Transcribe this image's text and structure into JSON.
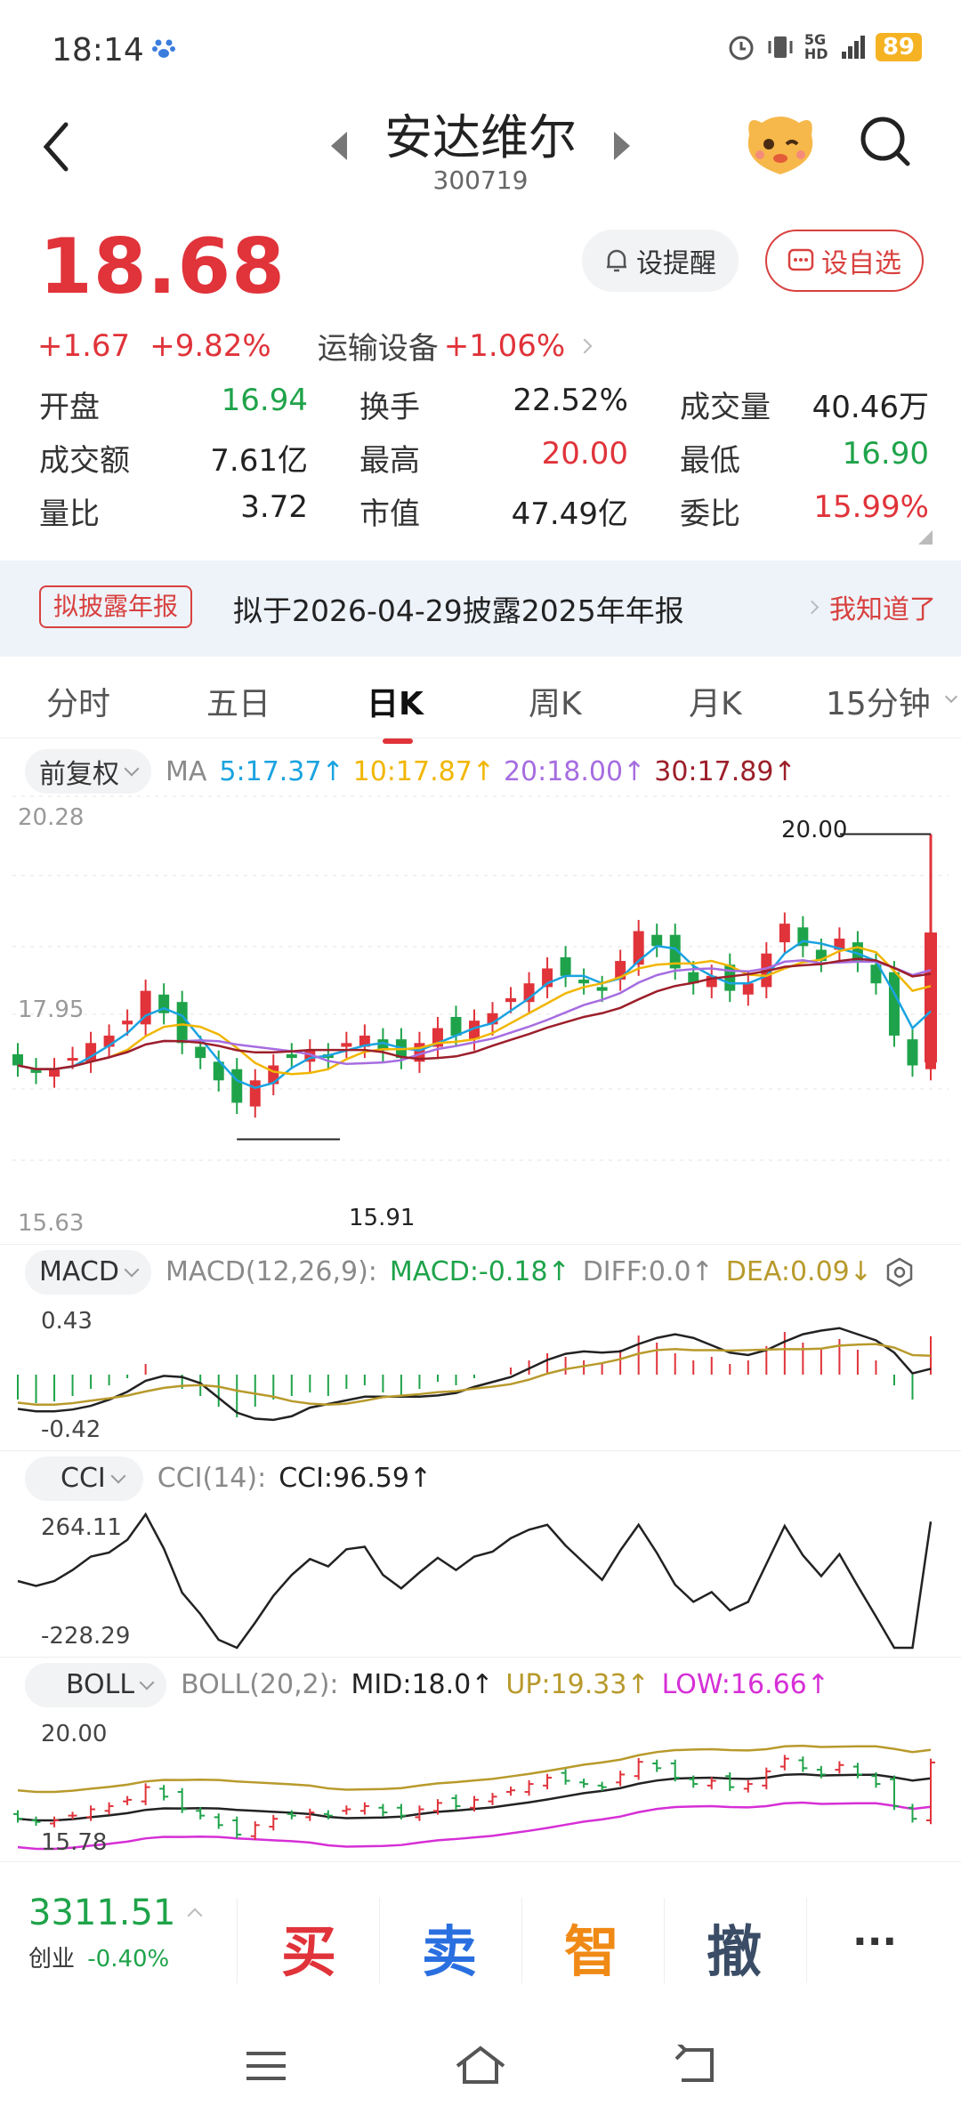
{
  "status_bar": {
    "time": "18:14",
    "network": "5G HD",
    "battery": "89"
  },
  "header": {
    "title": "安达维尔",
    "code": "300719"
  },
  "quote": {
    "price": "18.68",
    "change": "+1.67",
    "change_pct": "+9.82%",
    "sector": "运输设备",
    "sector_change": "+1.06%",
    "remind_label": "设提醒",
    "watch_label": "设自选",
    "stats": [
      [
        {
          "label": "开盘",
          "value": "16.94",
          "color": "green"
        },
        {
          "label": "换手",
          "value": "22.52%",
          "color": "dark"
        },
        {
          "label": "成交量",
          "value": "40.46万",
          "color": "dark"
        }
      ],
      [
        {
          "label": "成交额",
          "value": "7.61亿",
          "color": "dark"
        },
        {
          "label": "最高",
          "value": "20.00",
          "color": "red"
        },
        {
          "label": "最低",
          "value": "16.90",
          "color": "green"
        }
      ],
      [
        {
          "label": "量比",
          "value": "3.72",
          "color": "dark"
        },
        {
          "label": "市值",
          "value": "47.49亿",
          "color": "dark"
        },
        {
          "label": "委比",
          "value": "15.99%",
          "color": "red"
        }
      ]
    ]
  },
  "notice": {
    "badge": "拟披露年报",
    "text": "拟于2026-04-29披露2025年年报",
    "action": "我知道了"
  },
  "tabs": [
    "分时",
    "五日",
    "日K",
    "周K",
    "月K",
    "15分钟"
  ],
  "active_tab": "日K",
  "kline": {
    "adjust": "前复权",
    "ma_label": "MA",
    "ma": [
      {
        "text": "5:17.37↑",
        "color": "#1aa3e0"
      },
      {
        "text": "10:17.87↑",
        "color": "#f1b600"
      },
      {
        "text": "20:18.00↑",
        "color": "#a66de0"
      },
      {
        "text": "30:17.89↑",
        "color": "#9c1f2a"
      }
    ],
    "ymax": "20.28",
    "ymid": "17.95",
    "ymin": "15.63",
    "high_mark": "20.00",
    "low_mark": "15.91"
  },
  "macd": {
    "name": "MACD",
    "params": "MACD(12,26,9):",
    "macd": "MACD:-0.18↑",
    "diff": "DIFF:0.0↑",
    "dea": "DEA:0.09↓",
    "ymax": "0.43",
    "ymin": "-0.42"
  },
  "cci": {
    "name": "CCI",
    "params": "CCI(14):",
    "value": "CCI:96.59↑",
    "ymax": "264.11",
    "ymin": "-228.29"
  },
  "boll": {
    "name": "BOLL",
    "params": "BOLL(20,2):",
    "mid": "MID:18.0↑",
    "up": "UP:19.33↑",
    "low": "LOW:16.66↑",
    "ymax": "20.00",
    "ymin": "15.78"
  },
  "index": {
    "value": "3311.51",
    "name": "创业",
    "change": "-0.40%"
  },
  "actions": {
    "buy": "买",
    "sell": "卖",
    "smart": "智",
    "cancel": "撤",
    "more": "···"
  },
  "colors": {
    "up": "#e0333a",
    "down": "#1fa34a",
    "accent": "#e0333a"
  }
}
